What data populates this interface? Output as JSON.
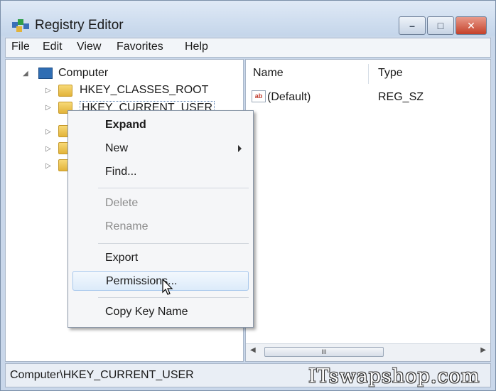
{
  "window": {
    "title": "Registry Editor",
    "controls": {
      "minimize": "–",
      "maximize": "□",
      "close": "✕"
    }
  },
  "menubar": [
    "File",
    "Edit",
    "View",
    "Favorites",
    "Help"
  ],
  "tree": {
    "root": "Computer",
    "items": [
      "HKEY_CLASSES_ROOT",
      "HKEY_CURRENT_USER"
    ]
  },
  "list": {
    "headers": {
      "name": "Name",
      "type": "Type"
    },
    "rows": [
      {
        "icon": "ab",
        "name": "(Default)",
        "type": "REG_SZ"
      }
    ],
    "scroll_thumb": "III"
  },
  "context_menu": {
    "items": [
      "Expand",
      "New",
      "Find...",
      "Delete",
      "Rename",
      "Export",
      "Permissions...",
      "Copy Key Name"
    ]
  },
  "statusbar": {
    "path": "Computer\\HKEY_CURRENT_USER",
    "watermark": "ITswapshop.com"
  },
  "colors": {
    "title_bg": "#c4d5ea",
    "close_button": "#c4412a",
    "menu_hover": "#dcebfa"
  },
  "icons": [
    "registry-editor-icon",
    "computer-icon",
    "folder-icon",
    "string-value-icon",
    "submenu-arrow-icon",
    "mouse-cursor-icon"
  ]
}
